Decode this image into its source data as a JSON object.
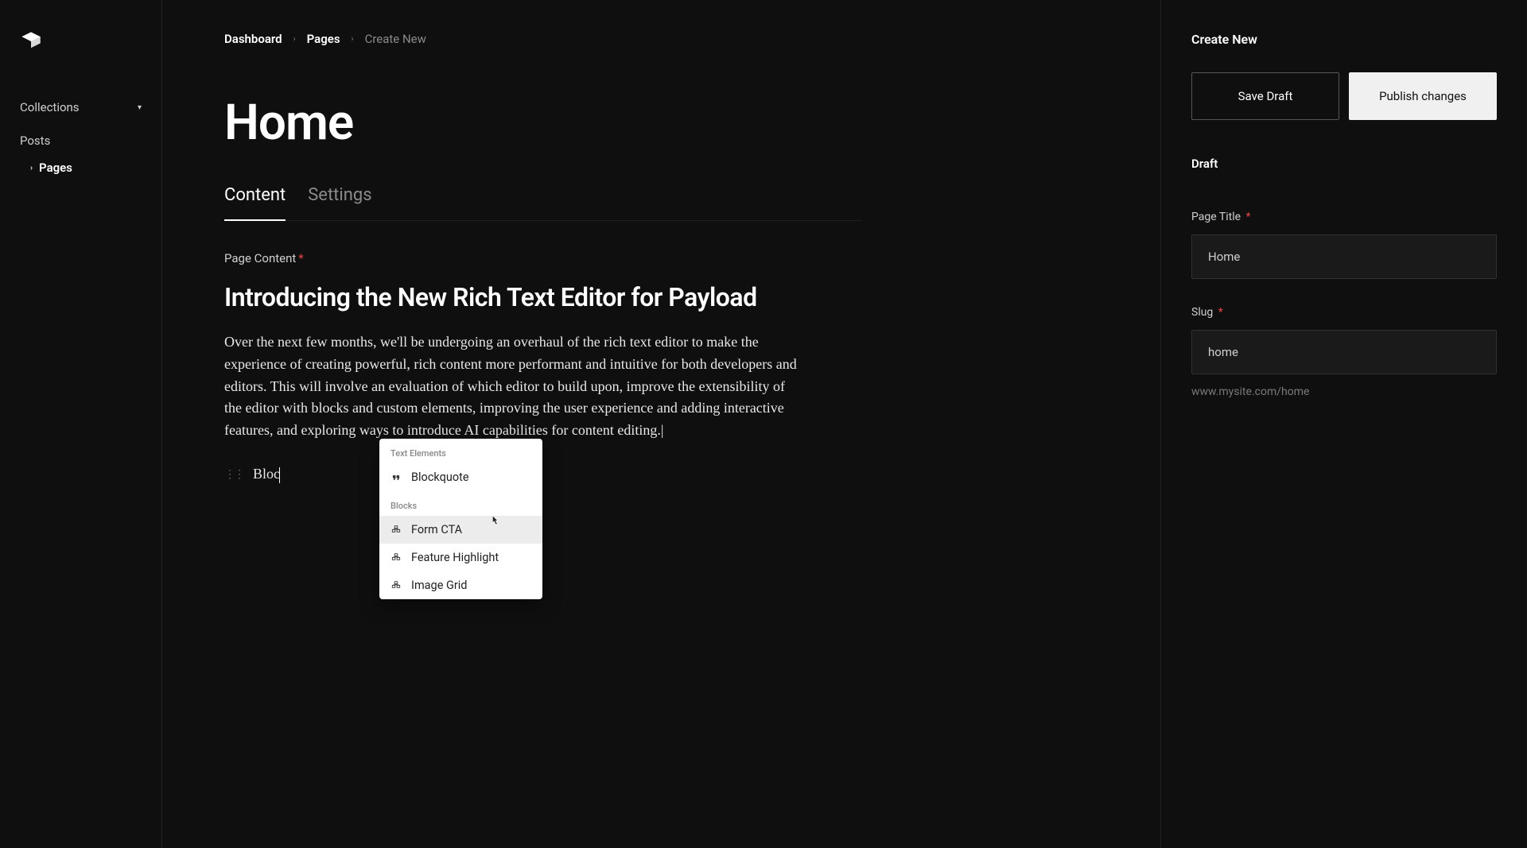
{
  "sidebar": {
    "group_label": "Collections",
    "items": [
      {
        "label": "Posts"
      }
    ],
    "subitems": [
      {
        "label": "Pages"
      }
    ]
  },
  "breadcrumbs": {
    "items": [
      {
        "label": "Dashboard",
        "current": false
      },
      {
        "label": "Pages",
        "current": false
      },
      {
        "label": "Create New",
        "current": true
      }
    ]
  },
  "page": {
    "title": "Home"
  },
  "tabs": [
    {
      "label": "Content",
      "active": true
    },
    {
      "label": "Settings",
      "active": false
    }
  ],
  "content": {
    "field_label": "Page Content",
    "heading": "Introducing the New Rich Text Editor for Payload",
    "body": "Over the next few months, we'll be undergoing an overhaul of the rich text editor to make the experience of creating powerful, rich content more performant and intuitive for both developers and editors. This will involve an evaluation of which editor to build upon, improve the extensibility of the editor with blocks and custom elements, improving the user experience and adding interactive features, and exploring ways to introduce AI capabilities for content editing.|",
    "block_input": "Bloc"
  },
  "popup": {
    "section1_header": "Text Elements",
    "section1_items": [
      {
        "icon": "quote-icon",
        "label": "Blockquote"
      }
    ],
    "section2_header": "Blocks",
    "section2_items": [
      {
        "icon": "block-icon",
        "label": "Form CTA",
        "hover": true
      },
      {
        "icon": "block-icon",
        "label": "Feature Highlight",
        "hover": false
      },
      {
        "icon": "block-icon",
        "label": "Image Grid",
        "hover": false
      }
    ]
  },
  "rail": {
    "heading": "Create New",
    "save_draft_label": "Save Draft",
    "publish_label": "Publish changes",
    "status_label": "Draft",
    "page_title_label": "Page Title",
    "page_title_value": "Home",
    "slug_label": "Slug",
    "slug_value": "home",
    "url_hint": "www.mysite.com/home"
  }
}
